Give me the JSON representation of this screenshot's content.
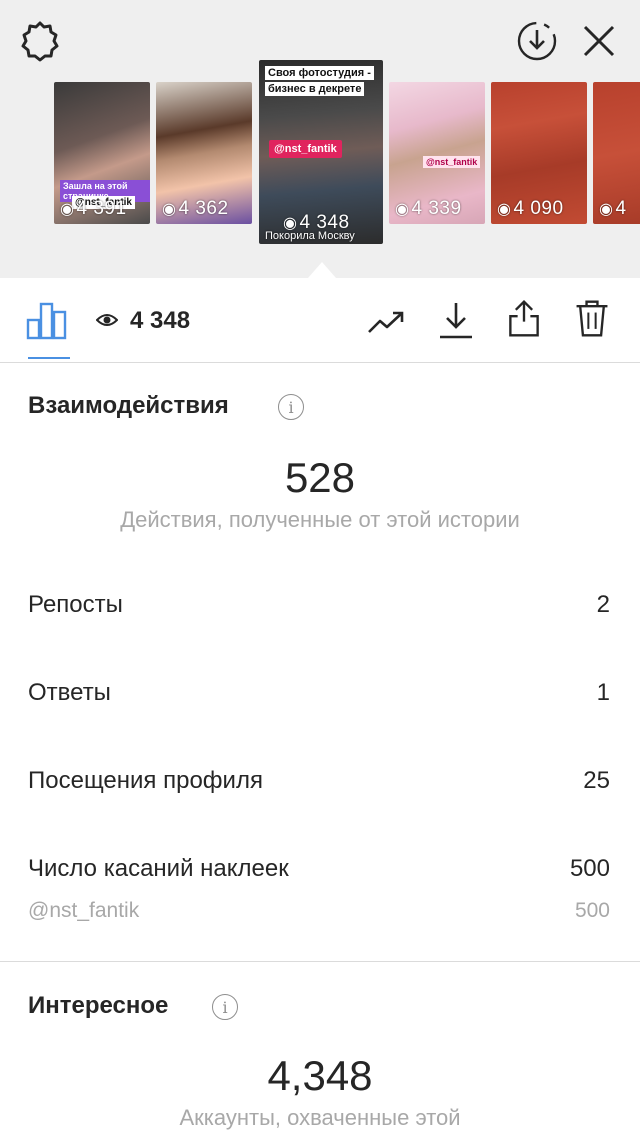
{
  "header": {
    "settings_icon": "gear-icon",
    "save_icon": "download-circle-icon",
    "close_icon": "close-icon"
  },
  "stories": [
    {
      "views": "4 391",
      "caption": "Зашла на этой страничке",
      "mention": "@nst_fantik"
    },
    {
      "views": "4 362"
    },
    {
      "views": "4 348",
      "title_line1": "Своя фотостудия -",
      "title_line2": "бизнес в декрете",
      "mention": "@nst_fantik",
      "bottom_text": "Покорила Москву"
    },
    {
      "views": "4 339",
      "mention": "@nst_fantik"
    },
    {
      "views": "4 090"
    },
    {
      "views": "4"
    }
  ],
  "toolbar": {
    "view_count": "4 348",
    "icons": [
      "bar-chart-icon",
      "eye-icon",
      "trend-icon",
      "download-icon",
      "share-icon",
      "trash-icon"
    ]
  },
  "interactions": {
    "title": "Взаимодействия",
    "info": "i",
    "total": "528",
    "caption": "Действия, полученные от этой истории",
    "rows": [
      {
        "label": "Репосты",
        "value": "2"
      },
      {
        "label": "Ответы",
        "value": "1"
      },
      {
        "label": "Посещения профиля",
        "value": "25"
      },
      {
        "label": "Число касаний наклеек",
        "value": "500"
      }
    ],
    "sub_row": {
      "label": "@nst_fantik",
      "value": "500"
    }
  },
  "discovery": {
    "title": "Интересное",
    "info": "i",
    "total": "4,348",
    "caption": "Аккаунты, охваченные этой"
  },
  "colors": {
    "accent": "#4a90e2",
    "text": "#262626",
    "muted": "#a8a8a8",
    "top_bg": "#efefef"
  }
}
